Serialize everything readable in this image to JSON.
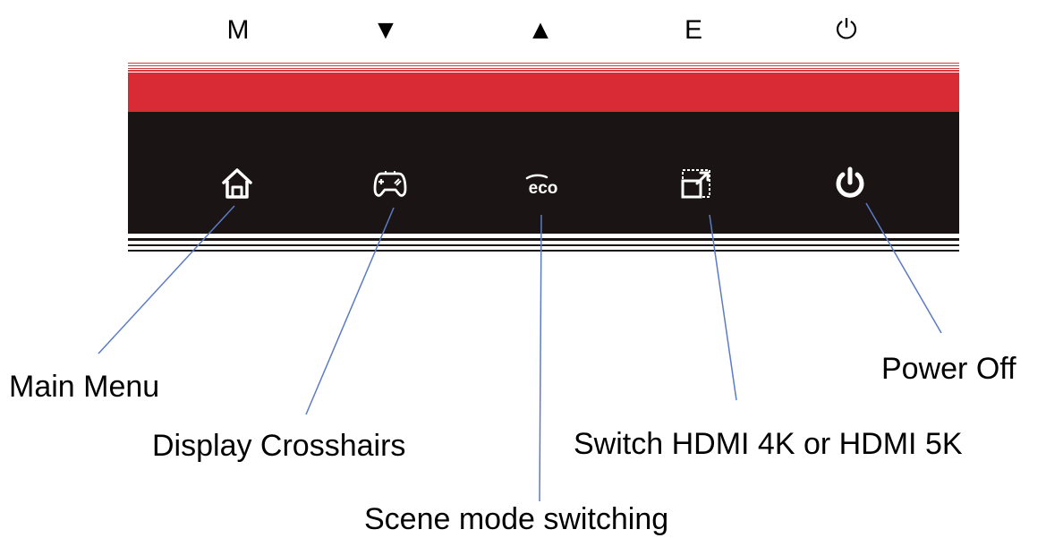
{
  "key_letters": [
    "M",
    "▼",
    "▲",
    "E",
    "⏻"
  ],
  "colors": {
    "red_band": "#d92b35",
    "black_band": "#1a1414",
    "icon": "#ffffff",
    "leader_line": "#5b7bc4"
  },
  "buttons": [
    {
      "icon": "home-icon",
      "label": "Main Menu"
    },
    {
      "icon": "gamepad-icon",
      "label": "Display Crosshairs"
    },
    {
      "icon": "eco-icon",
      "label": "Scene mode switching"
    },
    {
      "icon": "resize-window-icon",
      "label": "Switch HDMI 4K or HDMI 5K"
    },
    {
      "icon": "power-icon",
      "label": "Power Off"
    }
  ],
  "eco_text": "eco"
}
